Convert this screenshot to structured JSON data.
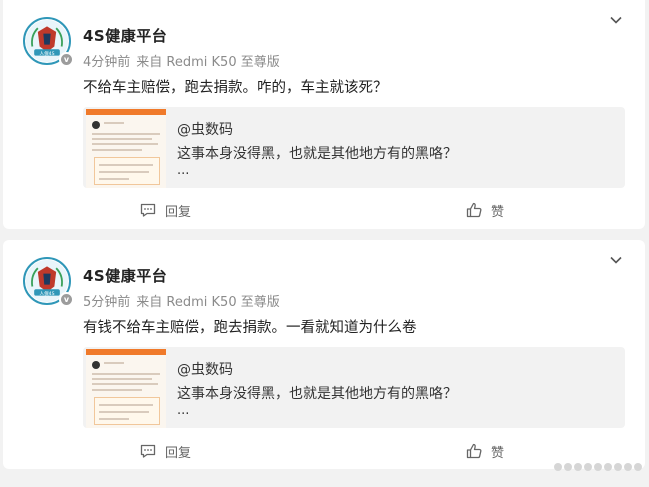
{
  "posts": [
    {
      "author": "4S健康平台",
      "avatar_text": "人保4S",
      "verify_badge": "v",
      "time": "4分钟前",
      "source": "来自 Redmi K50 至尊版",
      "text": "不给车主赔偿，跑去捐款。咋的，车主就该死？",
      "quote_author": "@虫数码",
      "quote_text": "这事本身没得黑，也就是其他地方有的黑咯？",
      "quote_more": "...",
      "reply_label": "回复",
      "like_label": "赞"
    },
    {
      "author": "4S健康平台",
      "avatar_text": "人保4S",
      "verify_badge": "v",
      "time": "5分钟前",
      "source": "来自 Redmi K50 至尊版",
      "text": "有钱不给车主赔偿，跑去捐款。一看就知道为什么卷",
      "quote_author": "@虫数码",
      "quote_text": "这事本身没得黑，也就是其他地方有的黑咯？",
      "quote_more": "...",
      "reply_label": "回复",
      "like_label": "赞"
    }
  ],
  "colors": {
    "avatar_ring": "#2f97b8",
    "thumb_header": "#f07a2a",
    "background": "#f2f2f2"
  }
}
